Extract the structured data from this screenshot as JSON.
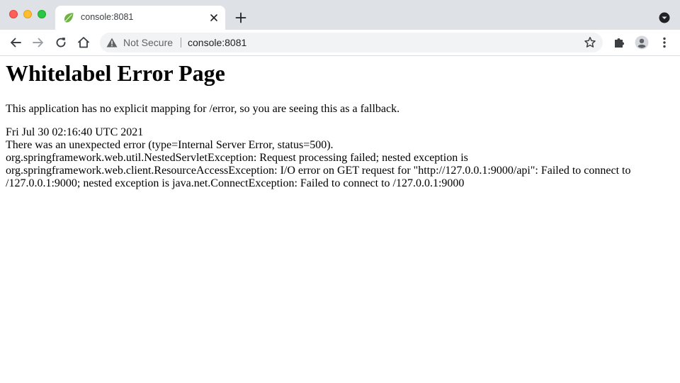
{
  "tab": {
    "title": "console:8081",
    "favicon": "spring-leaf-icon"
  },
  "toolbar": {
    "security_label": "Not Secure",
    "url": "console:8081"
  },
  "page": {
    "heading": "Whitelabel Error Page",
    "message": "This application has no explicit mapping for /error, so you are seeing this as a fallback.",
    "timestamp": "Fri Jul 30 02:16:40 UTC 2021",
    "error_summary": "There was an unexpected error (type=Internal Server Error, status=500).",
    "trace_lines": [
      "org.springframework.web.util.NestedServletException: Request processing failed; nested exception is",
      "org.springframework.web.client.ResourceAccessException: I/O error on GET request for \"http://127.0.0.1:9000/api\": Failed to connect to",
      "/127.0.0.1:9000; nested exception is java.net.ConnectException: Failed to connect to /127.0.0.1:9000"
    ]
  },
  "colors": {
    "tabstrip": "#dee1e6",
    "omnibox": "#f1f3f4",
    "spring_green": "#6db33f",
    "icon_gray": "#5f6368"
  }
}
